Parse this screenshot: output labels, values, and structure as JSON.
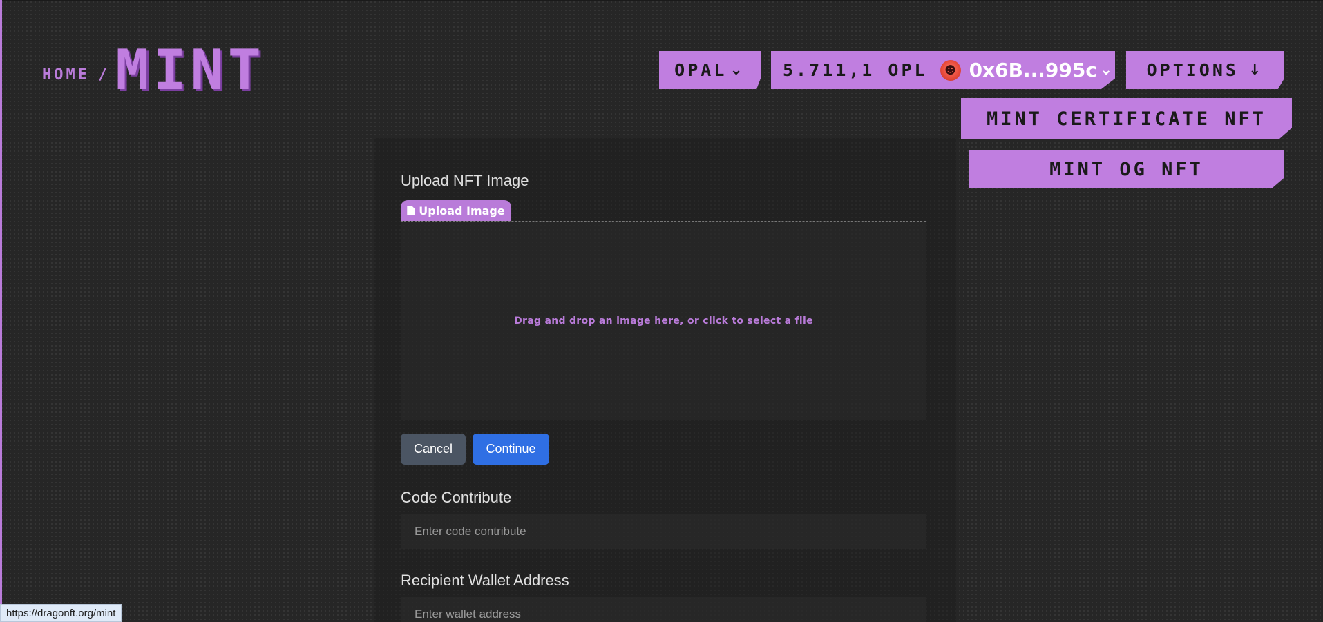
{
  "breadcrumb": {
    "home": "HOME",
    "separator": "/",
    "title": "MINT"
  },
  "header": {
    "network": {
      "label": "OPAL",
      "icon": "chevron-down-icon"
    },
    "wallet": {
      "balance": "5.711,1 OPL",
      "address": "0x6B...995c",
      "avatar_icon": "avatar-icon",
      "icon": "chevron-down-icon"
    },
    "options": {
      "label": "OPTIONS",
      "icon": "arrow-down-icon"
    },
    "mint_certificate_label": "MINT CERTIFICATE NFT",
    "mint_og_label": "MINT OG NFT"
  },
  "upload": {
    "label": "Upload NFT Image",
    "tab_label": "Upload Image",
    "tab_icon": "document-icon",
    "dropzone_text": "Drag and drop an image here, or click to select a file"
  },
  "actions": {
    "cancel": "Cancel",
    "continue": "Continue"
  },
  "code_contribute": {
    "label": "Code Contribute",
    "placeholder": "Enter code contribute"
  },
  "recipient": {
    "label": "Recipient Wallet Address",
    "placeholder": "Enter wallet address"
  },
  "status_bar": {
    "url": "https://dragonft.org/mint"
  },
  "colors": {
    "accent": "#c07ee0",
    "primary_button": "#2f6fe4",
    "secondary_button": "#4b5563",
    "background": "#262626"
  }
}
